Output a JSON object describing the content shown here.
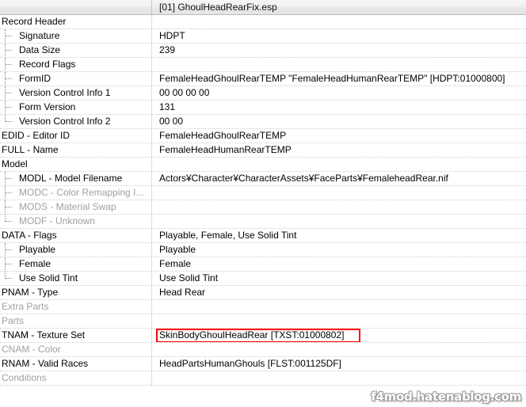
{
  "header": {
    "left_label": "",
    "tab_title": "[01] GhoulHeadRearFix.esp"
  },
  "watermark": "f4mod.hatenablog.com",
  "colors": {
    "highlight_border": "#ff0000",
    "disabled_text": "#a0a0a0",
    "grid_line": "#cfcfcf"
  },
  "rows": [
    {
      "key": "Record Header",
      "value": ""
    },
    {
      "key": "Signature",
      "value": "HDPT"
    },
    {
      "key": "Data Size",
      "value": "239"
    },
    {
      "key": "Record Flags",
      "value": ""
    },
    {
      "key": "FormID",
      "value": "FemaleHeadGhoulRearTEMP \"FemaleHeadHumanRearTEMP\" [HDPT:01000800]"
    },
    {
      "key": "Version Control Info 1",
      "value": "00 00 00 00"
    },
    {
      "key": "Form Version",
      "value": "131"
    },
    {
      "key": "Version Control Info 2",
      "value": "00 00"
    },
    {
      "key": "EDID - Editor ID",
      "value": "FemaleHeadGhoulRearTEMP"
    },
    {
      "key": "FULL - Name",
      "value": "FemaleHeadHumanRearTEMP"
    },
    {
      "key": "Model",
      "value": ""
    },
    {
      "key": "MODL - Model Filename",
      "value": "Actors¥Character¥CharacterAssets¥FaceParts¥FemaleheadRear.nif"
    },
    {
      "key": "MODC - Color Remapping I...",
      "value": ""
    },
    {
      "key": "MODS - Material Swap",
      "value": ""
    },
    {
      "key": "MODF - Unknown",
      "value": ""
    },
    {
      "key": "DATA - Flags",
      "value": "Playable, Female, Use Solid Tint"
    },
    {
      "key": "Playable",
      "value": "Playable"
    },
    {
      "key": "Female",
      "value": "Female"
    },
    {
      "key": "Use Solid Tint",
      "value": "Use Solid Tint"
    },
    {
      "key": "PNAM - Type",
      "value": "Head Rear"
    },
    {
      "key": "Extra Parts",
      "value": ""
    },
    {
      "key": "Parts",
      "value": ""
    },
    {
      "key": "TNAM - Texture Set",
      "value": "SkinBodyGhoulHeadRear [TXST:01000802]"
    },
    {
      "key": "CNAM - Color",
      "value": ""
    },
    {
      "key": "RNAM - Valid Races",
      "value": "HeadPartsHumanGhouls [FLST:001125DF]"
    },
    {
      "key": "Conditions",
      "value": ""
    }
  ]
}
